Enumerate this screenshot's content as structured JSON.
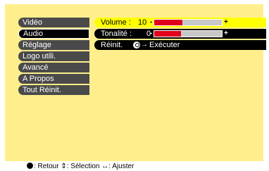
{
  "menu": {
    "items": [
      {
        "label": "Vidéo"
      },
      {
        "label": "Audio"
      },
      {
        "label": "Réglage"
      },
      {
        "label": "Logo utili."
      },
      {
        "label": "Avancé"
      },
      {
        "label": "A Propos"
      },
      {
        "label": "Tout Réinit."
      }
    ],
    "selected": "Audio"
  },
  "panel": {
    "volume": {
      "label": "Volume :",
      "value": "10",
      "minus": "-",
      "plus": "+",
      "level": 0.42
    },
    "tonalite": {
      "label": "Tonalité :",
      "value": "0",
      "minus": "-",
      "plus": "+",
      "level": 0.4
    },
    "reinit": {
      "label": "Réinit.",
      "action": "Exécuter",
      "arrow": "→"
    }
  },
  "statusbar": {
    "back": ": Retour",
    "select_icon": "⇕",
    "select": ": Sélection",
    "adjust_icon": "↔",
    "adjust": ": Ajuster"
  },
  "colors": {
    "background": "#ffef8c",
    "highlight": "#ffff00",
    "bar_fill": "#e0001c"
  }
}
